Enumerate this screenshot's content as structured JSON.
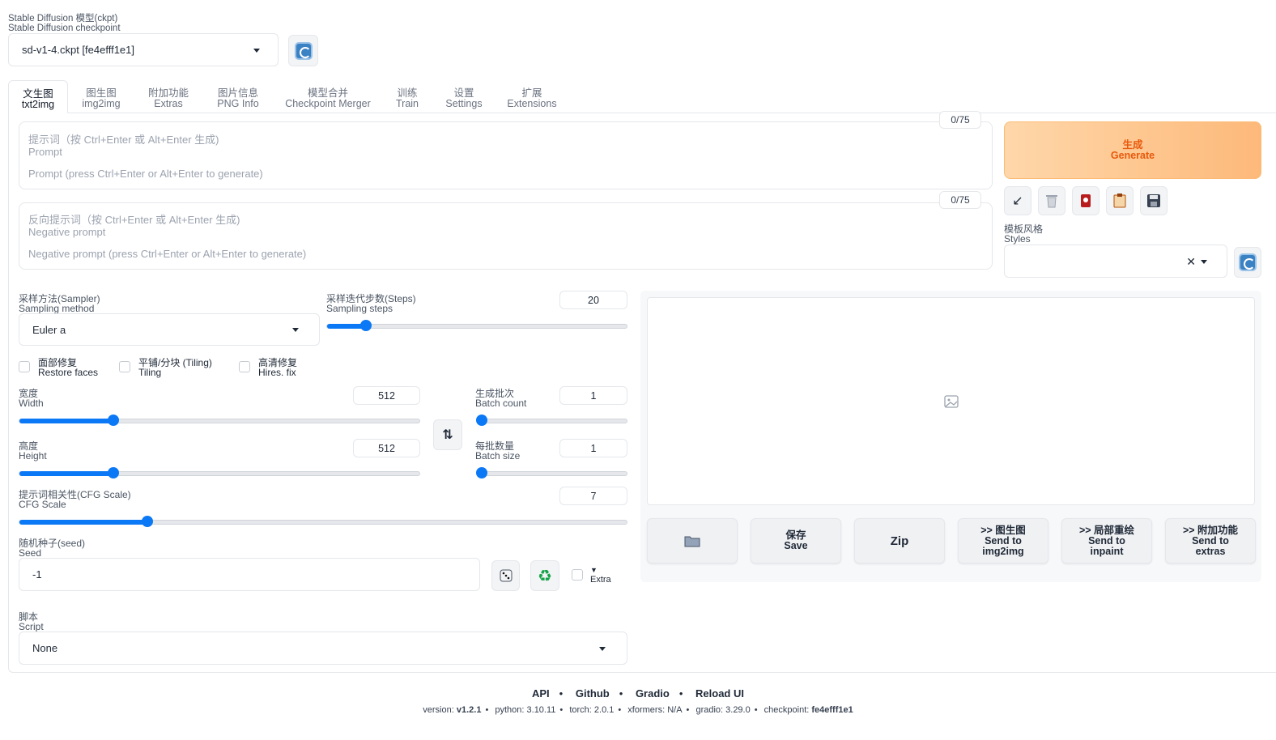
{
  "checkpoint": {
    "label_zh": "Stable Diffusion 模型(ckpt)",
    "label_en": "Stable Diffusion checkpoint",
    "value": "sd-v1-4.ckpt [fe4efff1e1]"
  },
  "tabs": [
    {
      "zh": "文生图",
      "en": "txt2img",
      "active": true
    },
    {
      "zh": "图生图",
      "en": "img2img"
    },
    {
      "zh": "附加功能",
      "en": "Extras"
    },
    {
      "zh": "图片信息",
      "en": "PNG Info"
    },
    {
      "zh": "模型合并",
      "en": "Checkpoint Merger"
    },
    {
      "zh": "训练",
      "en": "Train"
    },
    {
      "zh": "设置",
      "en": "Settings"
    },
    {
      "zh": "扩展",
      "en": "Extensions"
    }
  ],
  "prompt": {
    "token_count": "0/75",
    "hint_zh": "提示词（按 Ctrl+Enter 或 Alt+Enter 生成)",
    "hint_en": "Prompt",
    "placeholder": "Prompt (press Ctrl+Enter or Alt+Enter to generate)"
  },
  "negative_prompt": {
    "token_count": "0/75",
    "hint_zh": "反向提示词（按 Ctrl+Enter 或 Alt+Enter 生成)",
    "hint_en": "Negative prompt",
    "placeholder": "Negative prompt (press Ctrl+Enter or Alt+Enter to generate)"
  },
  "generate": {
    "zh": "生成",
    "en": "Generate"
  },
  "tool_icons": [
    "arrow-icon",
    "trash-icon",
    "card-icon",
    "clipboard-icon",
    "save-icon"
  ],
  "styles": {
    "label_zh": "模板风格",
    "label_en": "Styles",
    "value": ""
  },
  "sampler": {
    "label_zh": "采样方法(Sampler)",
    "label_en": "Sampling method",
    "value": "Euler a"
  },
  "steps": {
    "label_zh": "采样迭代步数(Steps)",
    "label_en": "Sampling steps",
    "value": "20",
    "fraction": 0.13
  },
  "checkboxes": [
    {
      "zh": "面部修复",
      "en": "Restore faces",
      "checked": false
    },
    {
      "zh": "平铺/分块 (Tiling)",
      "en": "Tiling",
      "checked": false
    },
    {
      "zh": "高清修复",
      "en": "Hires. fix",
      "checked": false
    }
  ],
  "width": {
    "label_zh": "宽度",
    "label_en": "Width",
    "value": "512",
    "fraction": 0.235
  },
  "height": {
    "label_zh": "高度",
    "label_en": "Height",
    "value": "512",
    "fraction": 0.235
  },
  "batch_count": {
    "label_zh": "生成批次",
    "label_en": "Batch count",
    "value": "1",
    "fraction": 0.0
  },
  "batch_size": {
    "label_zh": "每批数量",
    "label_en": "Batch size",
    "value": "1",
    "fraction": 0.0
  },
  "cfg": {
    "label_zh": "提示词相关性(CFG Scale)",
    "label_en": "CFG Scale",
    "value": "7",
    "fraction": 0.21
  },
  "seed": {
    "label_zh": "随机种子(seed)",
    "label_en": "Seed",
    "value": "-1",
    "extra_label": "Extra"
  },
  "script": {
    "label_zh": "脚本",
    "label_en": "Script",
    "value": "None"
  },
  "output_buttons": [
    {
      "icon": "folder-icon"
    },
    {
      "zh": "保存",
      "en": "Save"
    },
    {
      "en": "Zip"
    },
    {
      "zh": ">> 图生图",
      "en": "Send to img2img"
    },
    {
      "zh": ">> 局部重绘",
      "en": "Send to inpaint"
    },
    {
      "zh": ">> 附加功能",
      "en": "Send to extras"
    }
  ],
  "footer": {
    "links": [
      "API",
      "Github",
      "Gradio",
      "Reload UI"
    ],
    "version_label": "version:",
    "version": "v1.2.1",
    "python": "python: 3.10.11",
    "torch": "torch: 2.0.1",
    "xformers": "xformers: N/A",
    "gradio": "gradio: 3.29.0",
    "checkpoint_label": "checkpoint:",
    "checkpoint": "fe4efff1e1"
  },
  "colors": {
    "accent": "#0b78f5",
    "generate_bg": "#fdb97a",
    "generate_text": "#e8590c"
  }
}
